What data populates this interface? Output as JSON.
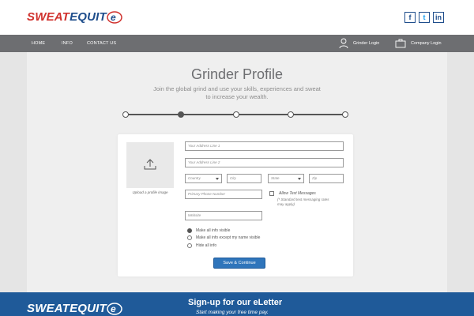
{
  "brand": {
    "part1": "SWEAT",
    "part2": "EQUIT",
    "mark": "e"
  },
  "social": {
    "facebook": "f",
    "twitter": "t",
    "linkedin": "in"
  },
  "nav": {
    "items": [
      "HOME",
      "INFO",
      "CONTACT US"
    ],
    "grinder_login": "Grinder Login",
    "company_login": "Company Login"
  },
  "page": {
    "title": "Grinder Profile",
    "subtitle": "Join the global grind and use your skills, experiences and sweat to increase your wealth.",
    "steps_total": 5,
    "current_step": 2
  },
  "form": {
    "photo_caption": "Upload a profile image",
    "address1_placeholder": "Your Address Line 1",
    "address2_placeholder": "Your Address Line 2",
    "country_placeholder": "Country",
    "city_placeholder": "City",
    "state_placeholder": "State",
    "zip_placeholder": "Zip",
    "phone_placeholder": "Primary Phone Number",
    "allow_text_label": "Allow Text Messages",
    "allow_text_note": "(* Standard text messaging rates may apply)",
    "website_placeholder": "Website",
    "visibility_options": [
      "Make all info visible",
      "Make all info except my name visible",
      "Hide all info"
    ],
    "visibility_selected": 0,
    "save_label": "Save & Continue"
  },
  "footer": {
    "title": "Sign-up for our eLetter",
    "subtitle": "Start making your free time pay."
  },
  "colors": {
    "brand_red": "#d0312d",
    "brand_blue": "#1f4e8c",
    "nav_gray": "#6d6e71",
    "button_blue": "#2f75bb",
    "footer_blue": "#1f5a99"
  }
}
